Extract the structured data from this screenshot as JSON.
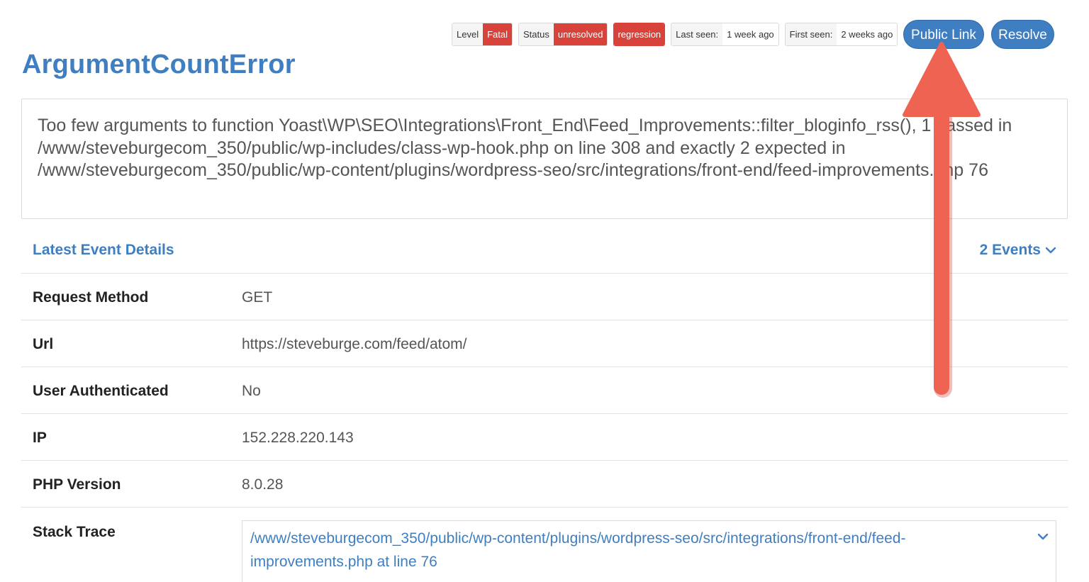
{
  "badges": {
    "level_key": "Level",
    "level_value": "Fatal",
    "status_key": "Status",
    "status_value": "unresolved",
    "regression": "regression",
    "last_seen_key": "Last seen:",
    "last_seen_value": "1 week ago",
    "first_seen_key": "First seen:",
    "first_seen_value": "2 weeks ago"
  },
  "actions": {
    "public_link": "Public Link",
    "resolve": "Resolve"
  },
  "title": "ArgumentCountError",
  "message": "Too few arguments to function Yoast\\WP\\SEO\\Integrations\\Front_End\\Feed_Improvements::filter_bloginfo_rss(), 1 passed in /www/steveburgecom_350/public/wp-includes/class-wp-hook.php on line 308 and exactly 2 expected in /www/steveburgecom_350/public/wp-content/plugins/wordpress-seo/src/integrations/front-end/feed-improvements.php 76",
  "details": {
    "heading": "Latest Event Details",
    "events_label": "2 Events",
    "rows": [
      {
        "key": "Request Method",
        "value": "GET"
      },
      {
        "key": "Url",
        "value": "https://steveburge.com/feed/atom/"
      },
      {
        "key": "User Authenticated",
        "value": "No"
      },
      {
        "key": "IP",
        "value": "152.228.220.143"
      },
      {
        "key": "PHP Version",
        "value": "8.0.28"
      }
    ],
    "stack_key": "Stack Trace",
    "stack_frame": "/www/steveburgecom_350/public/wp-content/plugins/wordpress-seo/src/integrations/front-end/feed-improvements.php at line 76"
  },
  "colors": {
    "accent": "#3f7fc1",
    "danger": "#d9423a",
    "annotation_arrow": "#ee6352"
  },
  "icons": {
    "events_toggle": "chevron-down-icon",
    "stack_toggle": "chevron-down-icon"
  }
}
